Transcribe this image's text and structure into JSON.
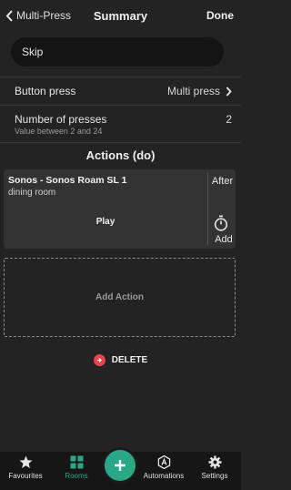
{
  "header": {
    "back_label": "Multi-Press",
    "title": "Summary",
    "done_label": "Done"
  },
  "name_input": {
    "value": "Skip",
    "placeholder": ""
  },
  "button_press": {
    "label": "Button press",
    "value": "Multi press"
  },
  "number_of_presses": {
    "label": "Number of presses",
    "value": "2",
    "hint": "Value between 2 and 24"
  },
  "actions": {
    "section_title": "Actions (do)",
    "items": [
      {
        "title": "Sonos - Sonos Roam SL 1",
        "subtitle": "dining room",
        "action": "Play",
        "after_label": "After",
        "add_label": "Add"
      }
    ],
    "add_action_label": "Add Action"
  },
  "delete": {
    "label": "DELETE"
  },
  "tabbar": {
    "items": [
      {
        "label": "Favourites",
        "icon": "star-icon"
      },
      {
        "label": "Rooms",
        "icon": "grid-icon",
        "active": true
      },
      {
        "label": "",
        "icon": "plus-icon"
      },
      {
        "label": "Automations",
        "icon": "automation-icon"
      },
      {
        "label": "Settings",
        "icon": "gear-icon"
      }
    ]
  },
  "colors": {
    "accent": "#2aa787",
    "danger": "#e8434f",
    "background": "#232323"
  }
}
